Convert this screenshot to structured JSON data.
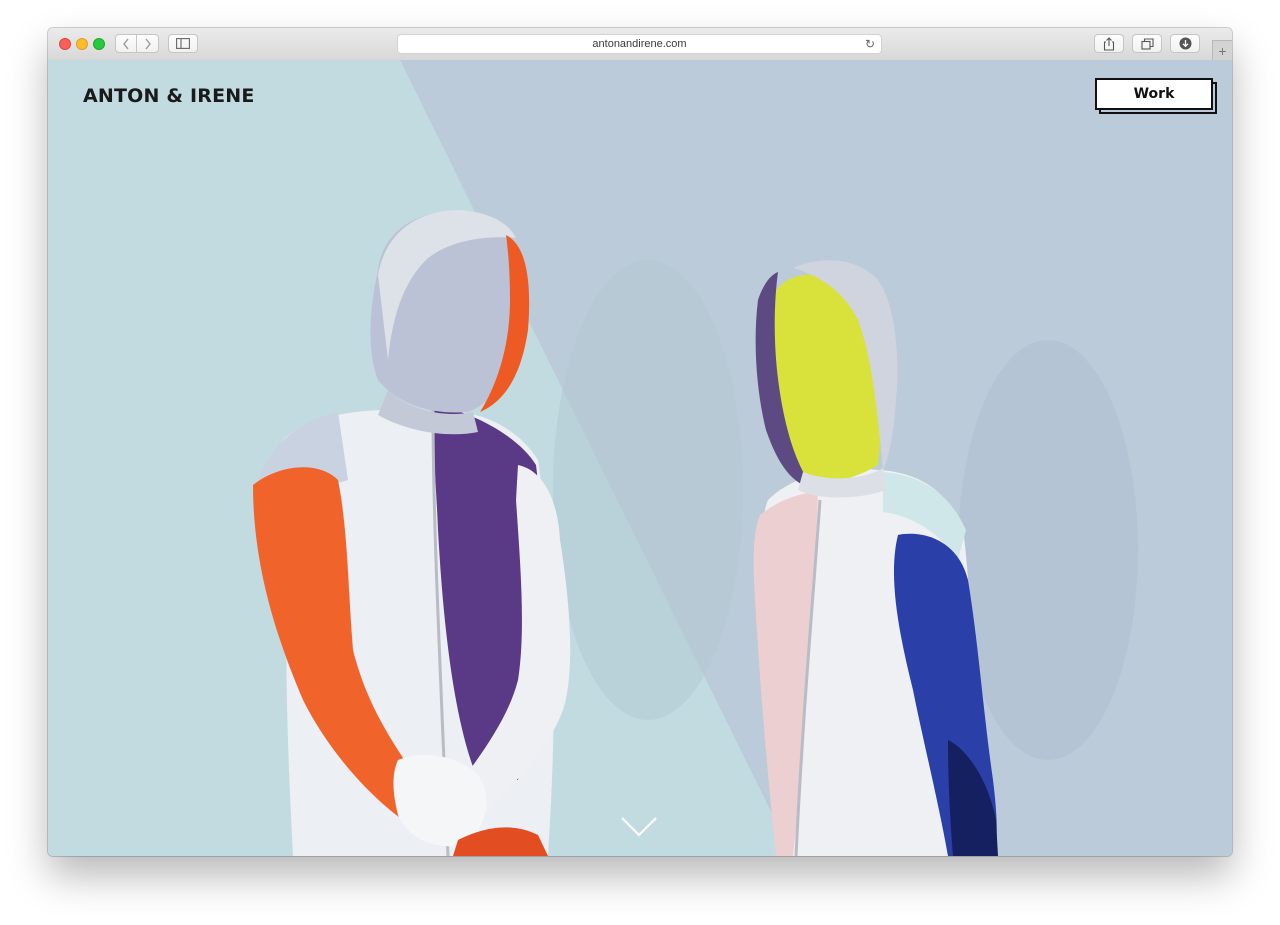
{
  "browser": {
    "url": "antonandirene.com",
    "controls": {
      "close": "close-button",
      "minimize": "minimize-button",
      "zoom": "zoom-button"
    },
    "icons": {
      "back": "chevron-left-icon",
      "forward": "chevron-right-icon",
      "sidebar": "sidebar-icon",
      "reload": "reload-icon",
      "share": "share-icon",
      "tabs": "tabs-icon",
      "downloads": "download-icon",
      "new_tab": "+"
    }
  },
  "site": {
    "logo": "ANTON & IRENE",
    "nav": {
      "work_label": "Work"
    },
    "scroll_hint_icon": "chevron-down-icon"
  },
  "colors": {
    "background_left": "#c1dbe1",
    "background_right": "#bccbda",
    "text": "#1a1a1a",
    "accent_orange": "#f0642c",
    "accent_purple": "#5e3a8c",
    "accent_yellow": "#d8e23a",
    "accent_blue": "#2a3fa8"
  }
}
